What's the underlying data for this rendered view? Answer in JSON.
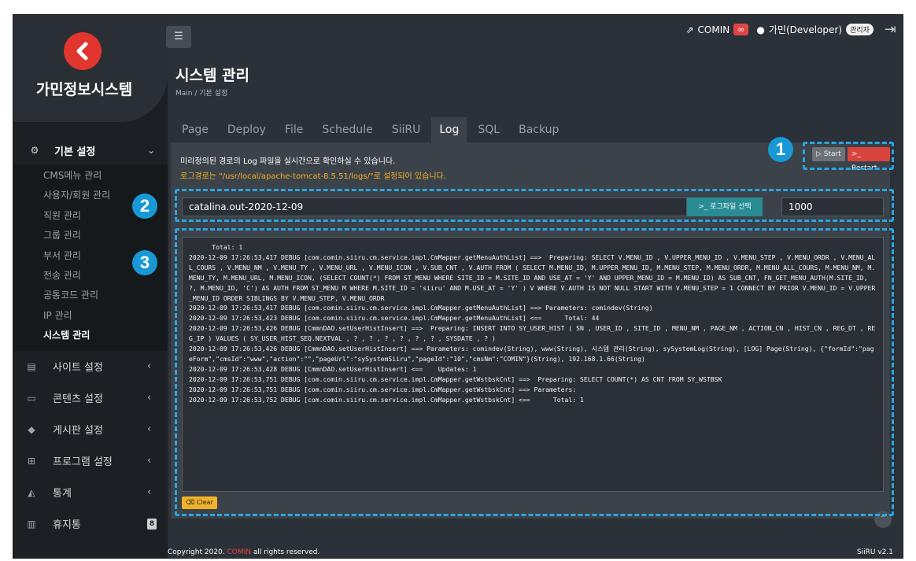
{
  "app": {
    "name": "가민정보시스템",
    "logo_icon": "logo-chevron-icon"
  },
  "topbar": {
    "site_link": "COMIN",
    "user": "가민(Developer)",
    "role": "관리자"
  },
  "page": {
    "title": "시스템 관리",
    "breadcrumb": "Main  /  기본 설정"
  },
  "sidebar": {
    "active_group": "기본 설정",
    "sub_items": [
      "CMS메뉴 관리",
      "사용자/회원 관리",
      "직원 관리",
      "그룹 관리",
      "부서 관리",
      "전송 관리",
      "공통코드 관리",
      "IP 관리",
      "시스템 관리"
    ],
    "groups": [
      {
        "label": "사이트 설정"
      },
      {
        "label": "콘텐츠 설정"
      },
      {
        "label": "게시판 설정"
      },
      {
        "label": "프로그램 설정"
      },
      {
        "label": "통계"
      },
      {
        "label": "휴지통",
        "count": "8"
      }
    ]
  },
  "tabs": [
    "Page",
    "Deploy",
    "File",
    "Schedule",
    "SiiRU",
    "Log",
    "SQL",
    "Backup"
  ],
  "active_tab": "Log",
  "log_panel": {
    "description": "미리정의된 경로의 Log 파일을 실시간으로 확인하실 수 있습니다.",
    "path_note": "로그경로는 \"/usr/local/apache-tomcat-8.5.51/logs/\"로 설정되어 있습니다.",
    "start_label": "▷ Start",
    "restart_label": ">_ Restart",
    "file_value": "catalina.out-2020-12-09",
    "file_button": ">_ 로그파일 선택",
    "line_count": "1000",
    "clear_label": "⌫ Clear",
    "log_lines": [
      "      Total: 1",
      "2020-12-09 17:26:53,417 DEBUG [com.comin.siiru.cm.service.impl.CmMapper.getMenuAuthList] ==>  Preparing: SELECT V.MENU_ID , V.UPPER_MENU_ID , V.MENU_STEP , V.MENU_ORDR , V.MENU_ALL_COURS , V.MENU_NM , V.MENU_TY , V.MENU_URL , V.MENU_ICON , V.SUB_CNT , V.AUTH FROM ( SELECT M.MENU_ID, M.UPPER_MENU_ID, M.MENU_STEP, M.MENU_ORDR, M.MENU_ALL_COURS, M.MENU_NM, M.MENU_TY, M.MENU_URL, M.MENU_ICON, (SELECT COUNT(*) FROM ST_MENU WHERE SITE_ID = M.SITE_ID AND USE_AT = 'Y' AND UPPER_MENU_ID = M.MENU_ID) AS SUB_CNT, FN_GET_MENU_AUTH(M.SITE_ID, ?, M.MENU_ID, 'C') AS AUTH FROM ST_MENU M WHERE M.SITE_ID = 'siiru' AND M.USE_AT = 'Y' ) V WHERE V.AUTH IS NOT NULL START WITH V.MENU_STEP = 1 CONNECT BY PRIOR V.MENU_ID = V.UPPER_MENU_ID ORDER SIBLINGS BY V.MENU_STEP, V.MENU_ORDR",
      "2020-12-09 17:26:53,417 DEBUG [com.comin.siiru.cm.service.impl.CmMapper.getMenuAuthList] ==> Parameters: comindev(String)",
      "2020-12-09 17:26:53,423 DEBUG [com.comin.siiru.cm.service.impl.CmMapper.getMenuAuthList] <==      Total: 44",
      "2020-12-09 17:26:53,426 DEBUG [CmmnDAO.setUserHistInsert] ==>  Preparing: INSERT INTO SY_USER_HIST ( SN , USER_ID , SITE_ID , MENU_NM , PAGE_NM , ACTION_CN , HIST_CN , REG_DT , REG_IP ) VALUES ( SY_USER_HIST_SEQ.NEXTVAL , ? , ? , ? , ? , ? , ? , SYSDATE , ? )",
      "2020-12-09 17:26:53,426 DEBUG [CmmnDAO.setUserHistInsert] ==> Parameters: comindev(String), www(String), 시스템 관리(String), sySystemLog(String), [LOG] Page(String), {\"formId\":\"pageForm\",\"cmsId\":\"www\",\"action\":\"\",\"pageUrl\":\"sySystemSiiru\",\"pageId\":\"10\",\"cmsNm\":\"COMIN\"}(String), 192.168.1.66(String)",
      "2020-12-09 17:26:53,428 DEBUG [CmmnDAO.setUserHistInsert] <==    Updates: 1",
      "2020-12-09 17:26:53,751 DEBUG [com.comin.siiru.cm.service.impl.CmMapper.getWstbskCnt] ==>  Preparing: SELECT COUNT(*) AS CNT FROM SY_WSTBSK",
      "2020-12-09 17:26:53,751 DEBUG [com.comin.siiru.cm.service.impl.CmMapper.getWstbskCnt] ==> Parameters:",
      "2020-12-09 17:26:53,752 DEBUG [com.comin.siiru.cm.service.impl.CmMapper.getWstbskCnt] <==      Total: 1"
    ]
  },
  "annotations": [
    "1",
    "2",
    "3"
  ],
  "footer": {
    "prefix": "Copyright 2020. ",
    "brand": "COMIN",
    "suffix": " all rights reserved.",
    "version": "SiiRU v2.1"
  },
  "colors": {
    "brand_red": "#e1352f",
    "annotation_blue": "#2aa6df",
    "accent_teal": "#2a8c93",
    "warning_yellow": "#f2b12a"
  }
}
